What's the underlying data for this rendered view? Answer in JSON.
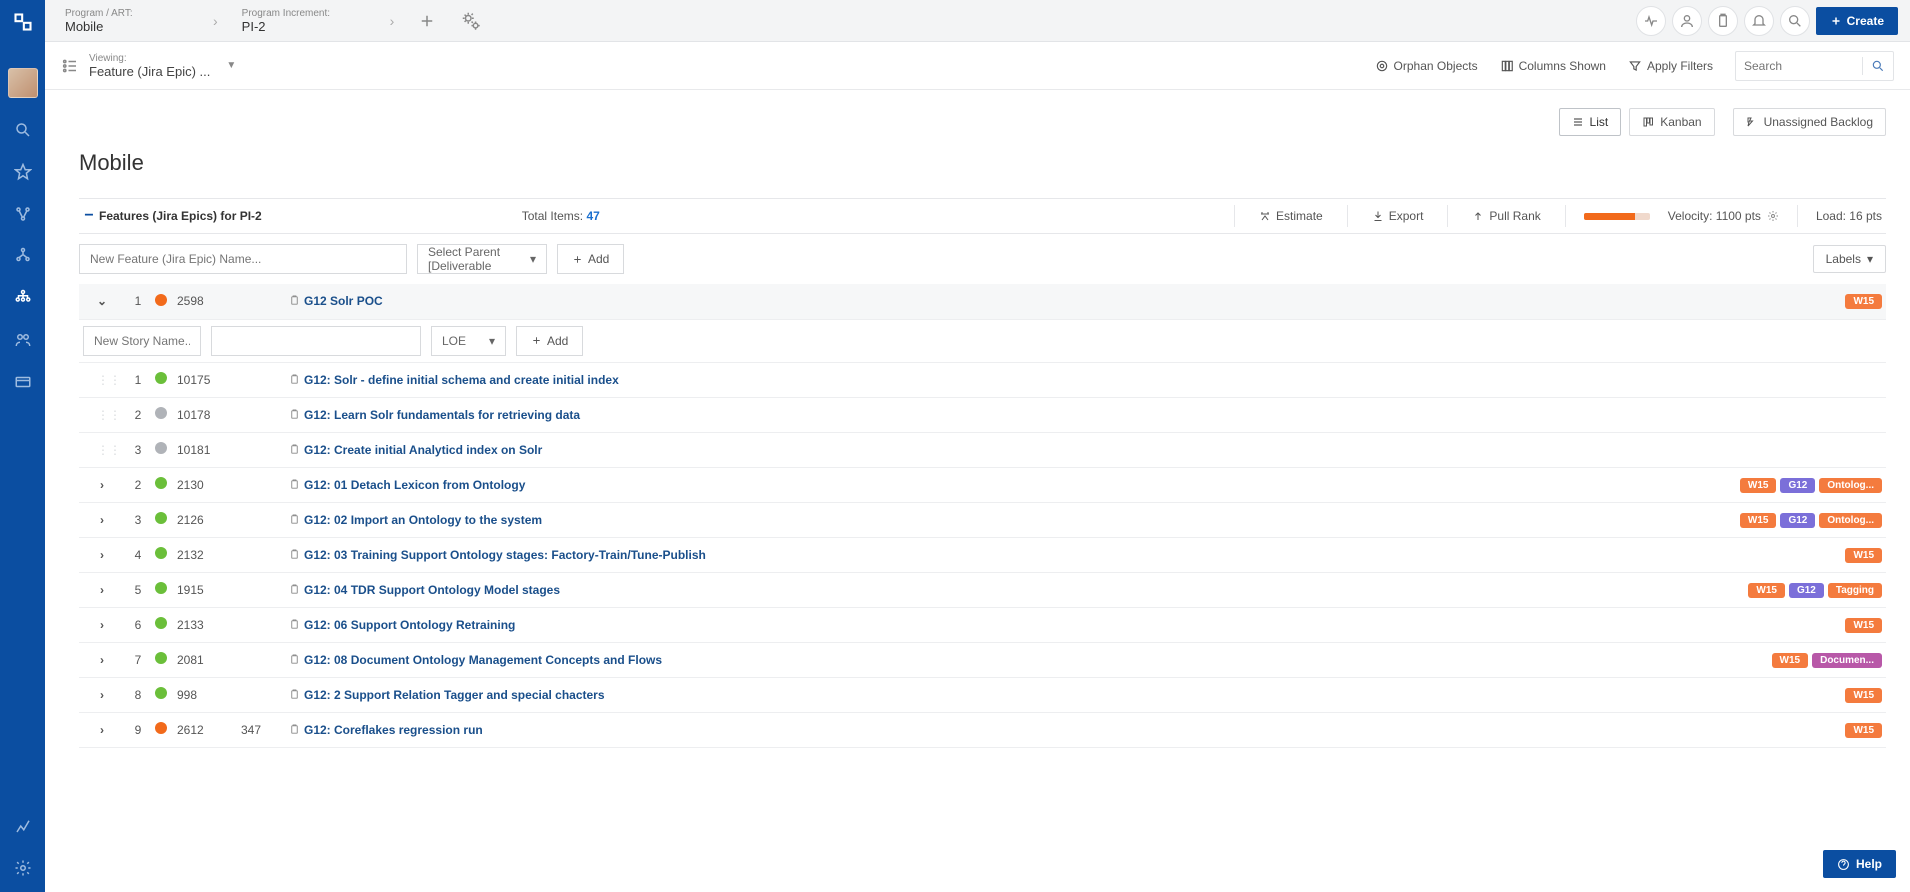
{
  "breadcrumb": {
    "program_label": "Program / ART:",
    "program_value": "Mobile",
    "pi_label": "Program Increment:",
    "pi_value": "PI-2"
  },
  "create_label": "Create",
  "viewing": {
    "label": "Viewing:",
    "value": "Feature (Jira Epic) ..."
  },
  "toolbar": {
    "orphan": "Orphan Objects",
    "columns": "Columns Shown",
    "filters": "Apply Filters",
    "search_placeholder": "Search"
  },
  "view_modes": {
    "list": "List",
    "kanban": "Kanban",
    "unassigned": "Unassigned Backlog"
  },
  "page_title": "Mobile",
  "section": {
    "title": "Features (Jira Epics) for  PI-2",
    "total_label": "Total Items:",
    "total_value": "47",
    "estimate": "Estimate",
    "export": "Export",
    "pullrank": "Pull Rank",
    "velocity": "Velocity: 1100 pts",
    "load": "Load: 16 pts"
  },
  "new_feature_placeholder": "New Feature (Jira Epic) Name...",
  "parent_placeholder": "Select Parent [Deliverable",
  "add_label": "Add",
  "labels_label": "Labels",
  "new_story_placeholder": "New Story Name...",
  "loe_label": "LOE",
  "stories": [
    {
      "num": "1",
      "id": "10175",
      "title": "G12: Solr - define initial schema and create initial index",
      "status": "green"
    },
    {
      "num": "2",
      "id": "10178",
      "title": "G12: Learn Solr fundamentals for retrieving data",
      "status": "grey"
    },
    {
      "num": "3",
      "id": "10181",
      "title": "G12: Create initial Analyticd index on Solr",
      "status": "grey"
    }
  ],
  "features": [
    {
      "num": "1",
      "id": "2598",
      "pts": "",
      "title": "G12 Solr POC",
      "status": "orange",
      "expanded": true,
      "tags": [
        "W15"
      ]
    },
    {
      "num": "2",
      "id": "2130",
      "pts": "",
      "title": "G12: 01 Detach Lexicon from Ontology",
      "status": "green",
      "tags": [
        "W15",
        "G12",
        "Ontolog..."
      ]
    },
    {
      "num": "3",
      "id": "2126",
      "pts": "",
      "title": "G12: 02 Import an Ontology to the system",
      "status": "green",
      "tags": [
        "W15",
        "G12",
        "Ontolog..."
      ]
    },
    {
      "num": "4",
      "id": "2132",
      "pts": "",
      "title": "G12: 03 Training Support Ontology stages: Factory-Train/Tune-Publish",
      "status": "green",
      "tags": [
        "W15"
      ]
    },
    {
      "num": "5",
      "id": "1915",
      "pts": "",
      "title": "G12: 04 TDR Support Ontology Model stages",
      "status": "green",
      "tags": [
        "W15",
        "G12",
        "Tagging"
      ]
    },
    {
      "num": "6",
      "id": "2133",
      "pts": "",
      "title": "G12: 06 Support Ontology Retraining",
      "status": "green",
      "tags": [
        "W15"
      ]
    },
    {
      "num": "7",
      "id": "2081",
      "pts": "",
      "title": "G12: 08 Document Ontology Management Concepts and Flows",
      "status": "green",
      "tags": [
        "W15",
        "Documen..."
      ]
    },
    {
      "num": "8",
      "id": "998",
      "pts": "",
      "title": "G12: 2 Support Relation Tagger and special chacters",
      "status": "green",
      "tags": [
        "W15"
      ]
    },
    {
      "num": "9",
      "id": "2612",
      "pts": "347",
      "title": "G12: Coreflakes regression run",
      "status": "orange",
      "tags": [
        "W15"
      ]
    }
  ],
  "help_label": "Help"
}
